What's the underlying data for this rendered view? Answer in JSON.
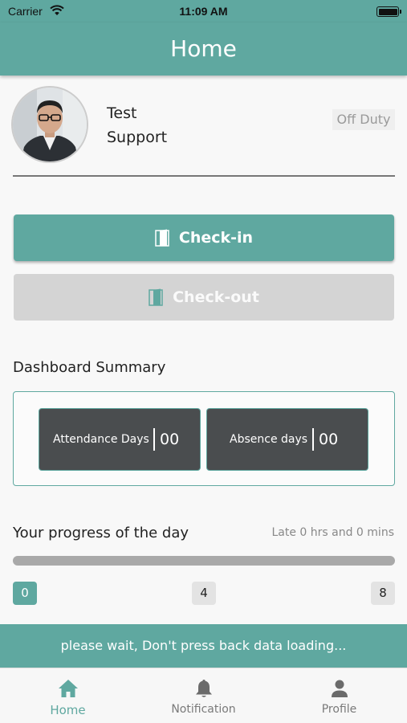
{
  "status_bar": {
    "carrier": "Carrier",
    "time": "11:09 AM",
    "wifi_icon": "wifi-icon",
    "battery_icon": "battery-icon"
  },
  "nav": {
    "title": "Home"
  },
  "profile": {
    "first_name": "Test",
    "last_name": "Support",
    "duty_status": "Off Duty",
    "avatar_icon": "user-photo"
  },
  "actions": {
    "checkin_label": "Check-in",
    "checkout_label": "Check-out",
    "door_icon": "door-icon"
  },
  "dashboard": {
    "title": "Dashboard Summary",
    "attendance_label": "Attendance Days",
    "attendance_value": "00",
    "absence_label": "Absence days",
    "absence_value": "00"
  },
  "progress": {
    "title": "Your progress of the day",
    "late_text": "Late 0 hrs and 0 mins",
    "value_fraction": 0,
    "ticks": [
      "0",
      "4",
      "8"
    ]
  },
  "loading": {
    "message": "please wait, Don't press back data loading..."
  },
  "tabs": [
    {
      "label": "Home",
      "icon": "home-icon",
      "active": true
    },
    {
      "label": "Notification",
      "icon": "bell-icon",
      "active": false
    },
    {
      "label": "Profile",
      "icon": "person-icon",
      "active": false
    }
  ],
  "colors": {
    "primary": "#5fa8a0",
    "dark_card": "#4a4d4f",
    "disabled": "#d4d4d4"
  }
}
